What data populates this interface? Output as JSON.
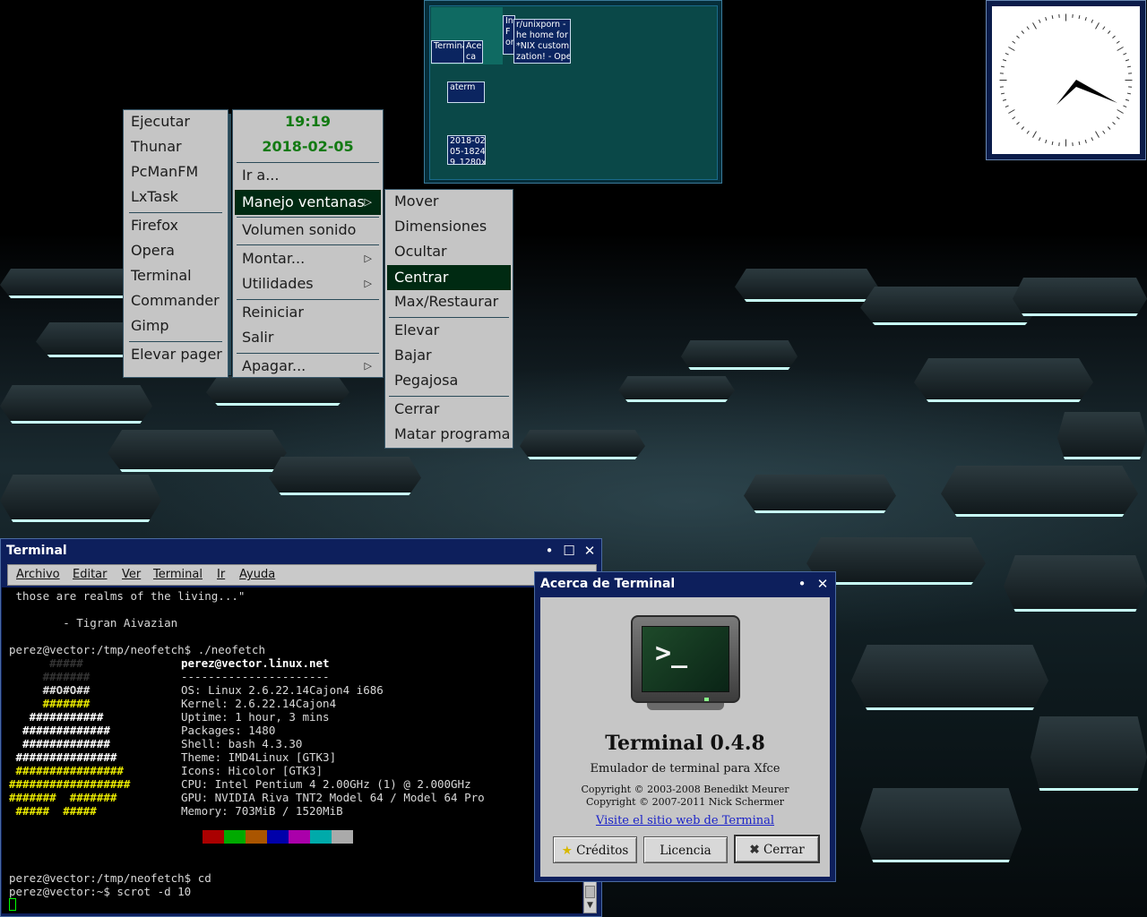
{
  "colors": {
    "menu_bg": "#c5c5c5",
    "menu_selected": "#002a12",
    "clock_green": "#137a13",
    "titlebar": "#0d1f5c",
    "pager_bg": "#0a4848",
    "accent_terminal": "#0a4a2a"
  },
  "left_menu": {
    "items": [
      "Ejecutar",
      "Thunar",
      "PcManFM",
      "LxTask",
      "Firefox",
      "Opera",
      "Terminal",
      "Commander",
      "Gimp",
      "Elevar pager"
    ]
  },
  "middle_menu": {
    "time": "19:19",
    "date": "2018-02-05",
    "items": [
      "Ir a...",
      "Manejo ventanas",
      "Volumen sonido",
      "Montar...",
      "Utilidades",
      "Reiniciar",
      "Salir",
      "Apagar..."
    ],
    "submenu_arrow": "▷"
  },
  "window_menu": {
    "items": [
      "Mover",
      "Dimensiones",
      "Ocultar",
      "Centrar",
      "Max/Restaurar",
      "Elevar",
      "Bajar",
      "Pegajosa",
      "Cerrar",
      "Matar programa"
    ],
    "selected": "Centrar"
  },
  "pager": {
    "windows": [
      "Terminal",
      "Ace ca d",
      "In F or",
      "r/unixporn - \nhe home for\n*NIX custom\nzation! - Ope",
      "aterm",
      "2018-02\n05-1824\n9_1280x"
    ]
  },
  "clock_widget": {
    "icon": "analog-clock-icon"
  },
  "terminal": {
    "title": "Terminal",
    "menubar": [
      "Archivo",
      "Editar",
      "Ver",
      "Terminal",
      "Ir",
      "Ayuda"
    ],
    "lines": [
      " those are realms of the living...\"",
      "",
      "        - Tigran Aivazian",
      "",
      "perez@vector:/tmp/neofetch$ ./neofetch",
      "perez@vector.linux.net",
      "----------------------",
      "OS: Linux 2.6.22.14Cajon4 i686",
      "Kernel: 2.6.22.14Cajon4",
      "Uptime: 1 hour, 3 mins",
      "Packages: 1480",
      "Shell: bash 4.3.30",
      "Theme: IMD4Linux [GTK3]",
      "Icons: Hicolor [GTK3]",
      "CPU: Intel Pentium 4 2.00GHz (1) @ 2.000GHz",
      "GPU: NVIDIA Riva TNT2 Model 64 / Model 64 Pro",
      "Memory: 703MiB / 1520MiB",
      "perez@vector:/tmp/neofetch$ cd",
      "perez@vector:~$ scrot -d 10"
    ],
    "ascii_logo": [
      "      #####",
      "     #######",
      "     ##O#O##",
      "     #######",
      "   ###########",
      "  #############",
      " ###############",
      " ################",
      "##################",
      "#######  #######",
      "#####  #######",
      " #####  #####"
    ],
    "palette": [
      "#aa0000",
      "#00aa00",
      "#aa5500",
      "#0000aa",
      "#aa00aa",
      "#00aaaa",
      "#aaaaaa"
    ]
  },
  "about": {
    "title": "Acerca de Terminal",
    "app_name": "Terminal 0.4.8",
    "description": "Emulador de terminal para Xfce",
    "copyright1": "Copyright © 2003-2008 Benedikt Meurer",
    "copyright2": "Copyright © 2007-2011 Nick Schermer",
    "link": "Visite el sitio web de Terminal",
    "buttons": {
      "credits": "Créditos",
      "license": "Licencia",
      "close": "Cerrar"
    }
  }
}
